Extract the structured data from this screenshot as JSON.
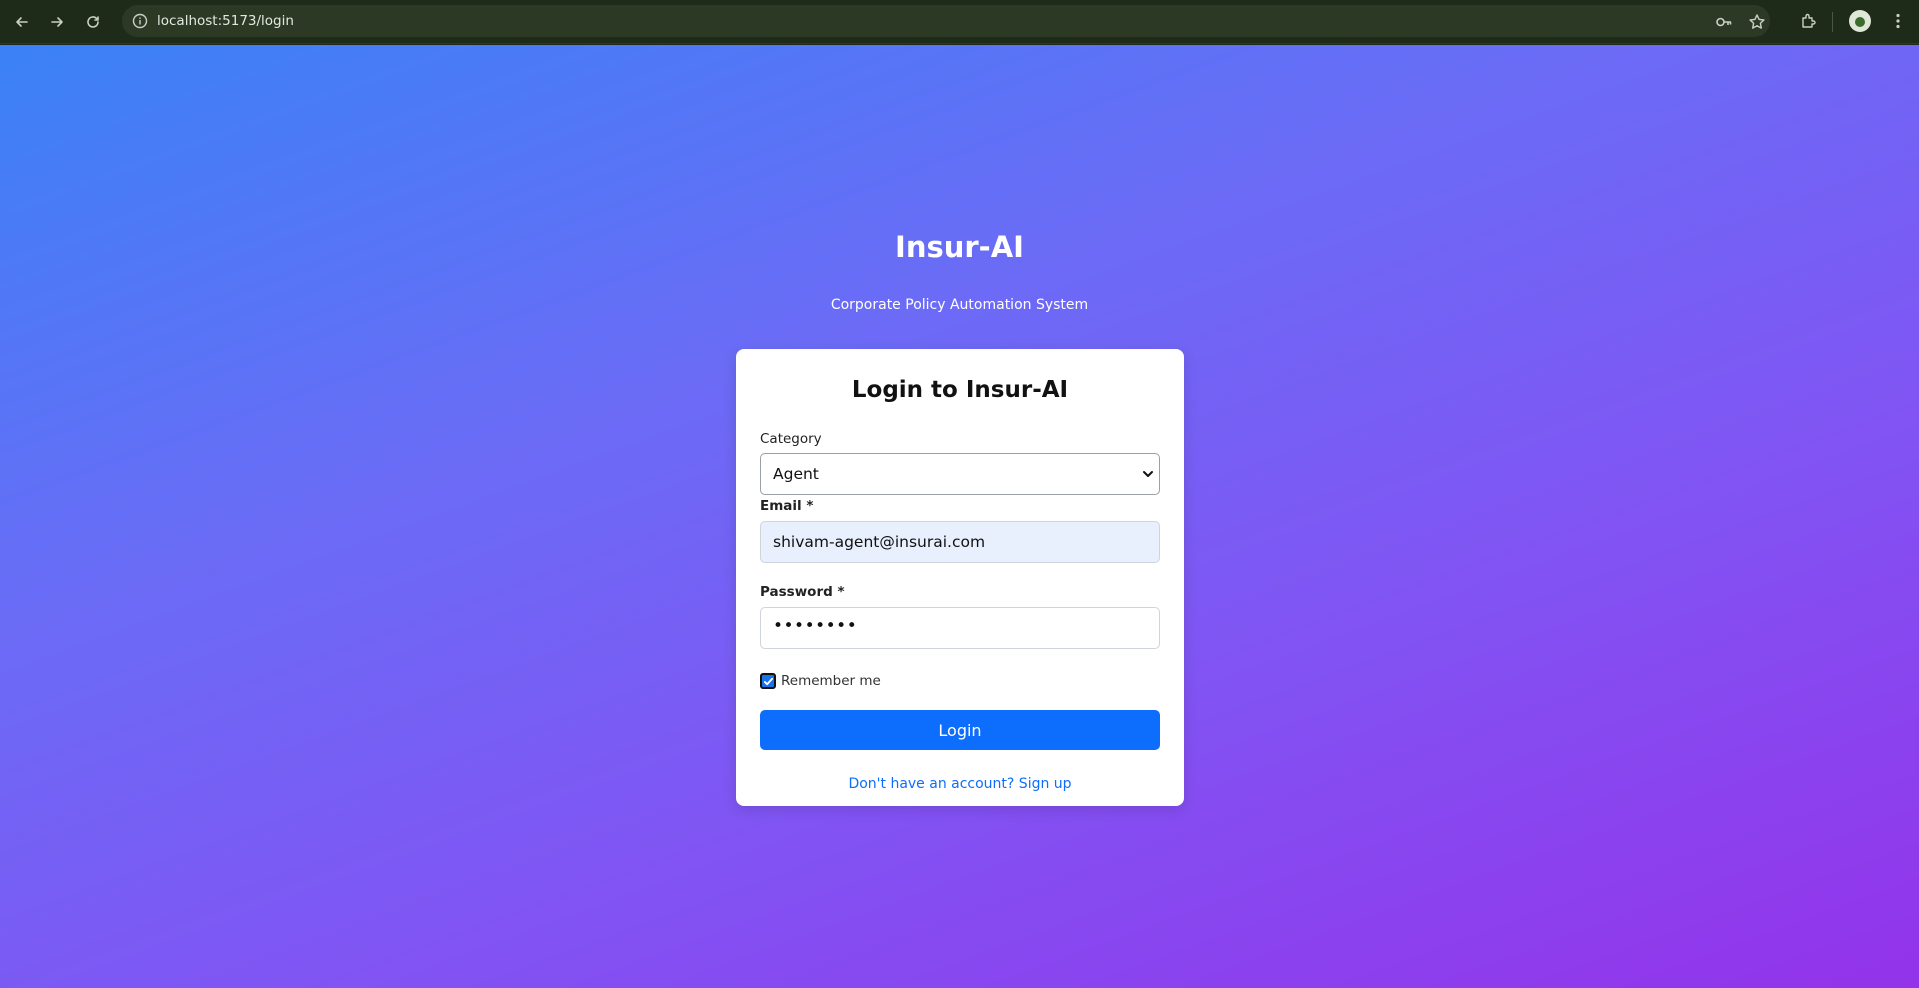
{
  "browser": {
    "url": "localhost:5173/login",
    "icons": [
      "back-icon",
      "forward-icon",
      "reload-icon",
      "info-icon",
      "key-icon",
      "star-icon",
      "extensions-icon",
      "avatar",
      "menu-icon"
    ]
  },
  "brand": {
    "title": "Insur-AI",
    "subtitle": "Corporate Policy Automation System"
  },
  "login": {
    "title": "Login to Insur-AI",
    "category_label": "Category",
    "category_value": "Agent",
    "email_label": "Email *",
    "email_value": "shivam-agent@insurai.com",
    "password_label": "Password *",
    "password_masked": "••••••••",
    "remember_label": "Remember me",
    "remember_checked": true,
    "submit_label": "Login",
    "signup_text": "Don't have an account? Sign up"
  },
  "colors": {
    "gradient_start": "#3b82f6",
    "gradient_end": "#9333ea",
    "primary": "#0d6efd",
    "card": "#ffffff"
  }
}
